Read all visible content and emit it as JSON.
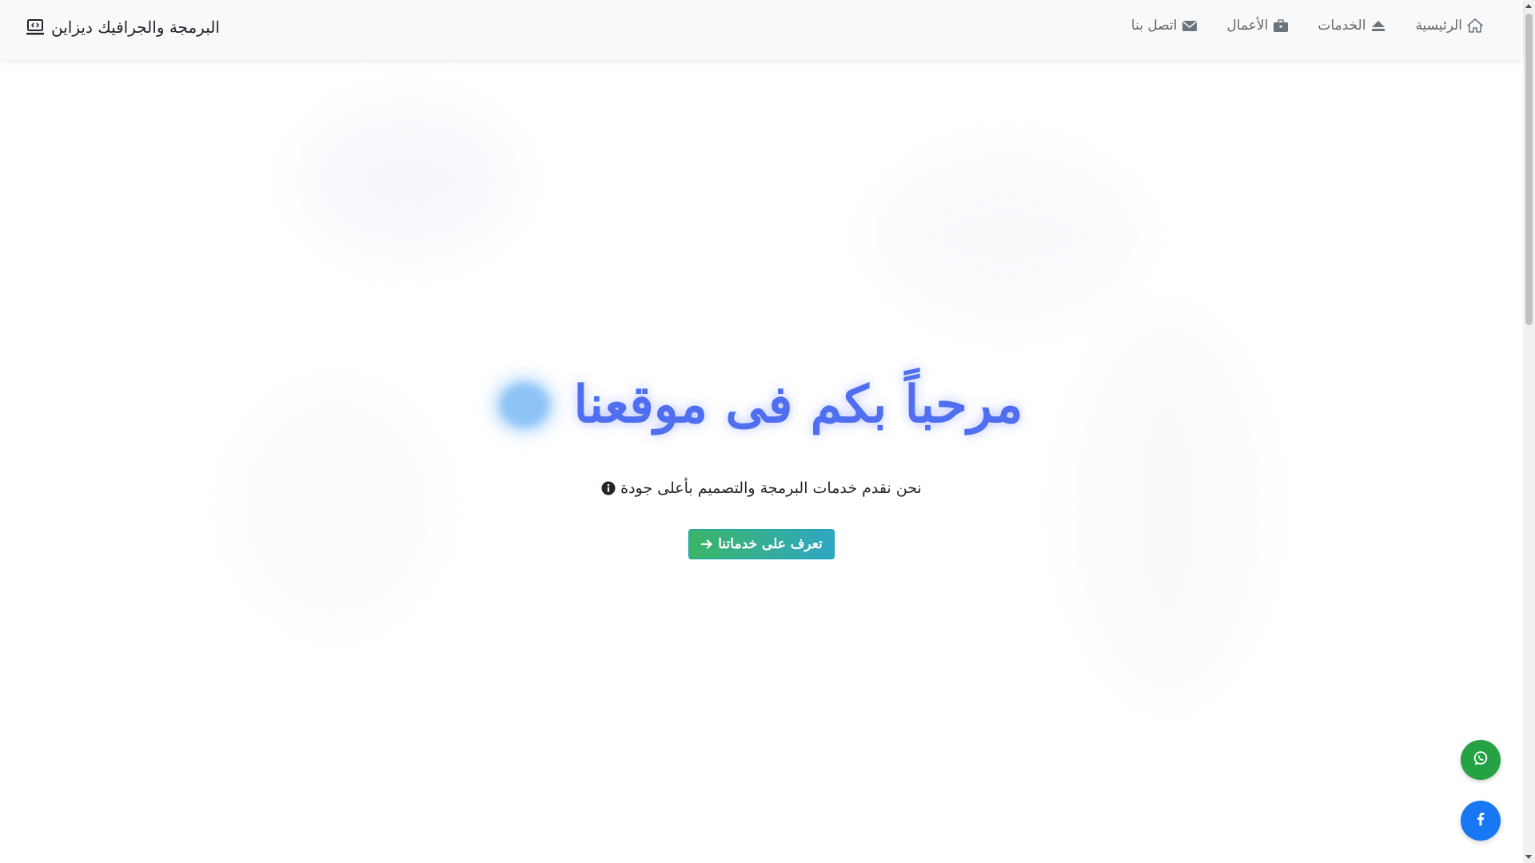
{
  "navbar": {
    "brand": {
      "label": "البرمجة والجرافيك ديزاين",
      "icon": "laptop-code-icon"
    },
    "links": [
      {
        "label": "الرئيسية",
        "icon": "home-icon"
      },
      {
        "label": "الخدمات",
        "icon": "eject-icon"
      },
      {
        "label": "الأعمال",
        "icon": "briefcase-icon"
      },
      {
        "label": "اتصل بنا",
        "icon": "envelope-icon"
      }
    ]
  },
  "hero": {
    "title": "مرحباً بكم فى موقعنا",
    "subtitle": "نحن نقدم خدمات البرمجة والتصميم بأعلى جودة",
    "subtitle_icon": "info-circle-icon",
    "cta": {
      "label": "تعرف على خدماتنا",
      "icon": "arrow-right-icon"
    }
  },
  "floating": {
    "whatsapp_icon": "whatsapp-icon",
    "facebook_icon": "facebook-icon"
  },
  "colors": {
    "navbar_bg": "#f8f9fa",
    "title": "#4f6ff0",
    "cta_gradient_start": "#3bb566",
    "cta_gradient_end": "#2fa7c4",
    "whatsapp": "#25a244",
    "facebook": "#1877f2"
  }
}
